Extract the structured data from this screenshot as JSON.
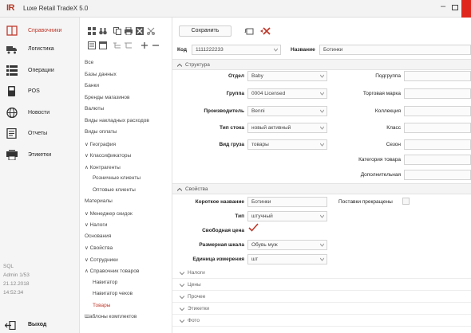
{
  "app": {
    "logo": "IR",
    "title": "Luxe Retail TradeX 5.0"
  },
  "colors": {
    "accent": "#c0392b",
    "close": "#e0271d"
  },
  "leftnav": {
    "items": [
      {
        "label": "Справочники",
        "icon": "book-icon",
        "active": true
      },
      {
        "label": "Логистика",
        "icon": "truck-icon"
      },
      {
        "label": "Операции",
        "icon": "list-icon"
      },
      {
        "label": "POS",
        "icon": "pos-terminal-icon"
      },
      {
        "label": "Новости",
        "icon": "globe-icon"
      },
      {
        "label": "Отчеты",
        "icon": "report-icon"
      },
      {
        "label": "Этикетки",
        "icon": "label-printer-icon"
      }
    ],
    "status": {
      "server": "SQL",
      "user": "Admin 1/53",
      "date": "21.12.2018",
      "time": "14:52:34"
    },
    "exit_label": "Выход"
  },
  "tree": {
    "items": [
      {
        "label": "Все",
        "indent": 0
      },
      {
        "label": "Базы данных",
        "indent": 1
      },
      {
        "label": "Банки",
        "indent": 1
      },
      {
        "label": "Бренды магазинов",
        "indent": 1
      },
      {
        "label": "Валюты",
        "indent": 1
      },
      {
        "label": "Виды накладных расходов",
        "indent": 1
      },
      {
        "label": "Виды оплаты",
        "indent": 1
      },
      {
        "label": "∨ География",
        "indent": 0
      },
      {
        "label": "∨ Классификаторы",
        "indent": 0
      },
      {
        "label": "∧ Контрагенты",
        "indent": 0
      },
      {
        "label": "Розничные клиенты",
        "indent": 2
      },
      {
        "label": "Оптовые клиенты",
        "indent": 2
      },
      {
        "label": "Материалы",
        "indent": 1
      },
      {
        "label": "∨ Менеджер скидок",
        "indent": 0
      },
      {
        "label": "∨ Налоги",
        "indent": 0
      },
      {
        "label": "Основания",
        "indent": 1
      },
      {
        "label": "∨ Свойства",
        "indent": 0
      },
      {
        "label": "∨ Сотрудники",
        "indent": 0
      },
      {
        "label": "∧ Справочник товаров",
        "indent": 0
      },
      {
        "label": "Навигатор",
        "indent": 2
      },
      {
        "label": "Навигатор чеков",
        "indent": 2
      },
      {
        "label": "Товары",
        "indent": 2,
        "active": true
      },
      {
        "label": "Шаблоны комплектов",
        "indent": 1
      }
    ]
  },
  "main": {
    "save_label": "Сохранить",
    "code_label": "Код",
    "code_value": "1111222233",
    "name_label": "Название",
    "name_value": "Ботинки",
    "structure": {
      "title": "Структура",
      "fields": [
        {
          "label": "Отдел",
          "value": "Baby"
        },
        {
          "label": "Группа",
          "value": "0004 Licensed"
        },
        {
          "label": "Производитель",
          "value": "Benni"
        },
        {
          "label": "Тип стока",
          "value": "новый активный"
        },
        {
          "label": "Вид груза",
          "value": "товары"
        }
      ],
      "right_fields": [
        {
          "label": "Подгруппа"
        },
        {
          "label": "Торговая марка"
        },
        {
          "label": "Коллекция"
        },
        {
          "label": "Класс"
        },
        {
          "label": "Сезон"
        },
        {
          "label": "Категория товара"
        },
        {
          "label": "Дополнительная"
        }
      ]
    },
    "properties": {
      "title": "Свойства",
      "short_name_label": "Короткое название",
      "short_name_value": "Ботинки",
      "type_label": "Тип",
      "type_value": "штучный",
      "free_price_label": "Свободная цена",
      "free_price_checked": true,
      "size_scale_label": "Размерная шкала",
      "size_scale_value": "Обувь муж",
      "unit_label": "Единица измерения",
      "unit_value": "шт",
      "discontinued_label": "Поставки прекращены"
    },
    "collapsed_sections": [
      "Налоги",
      "Цены",
      "Прочее",
      "Этикетки",
      "Фото"
    ]
  }
}
